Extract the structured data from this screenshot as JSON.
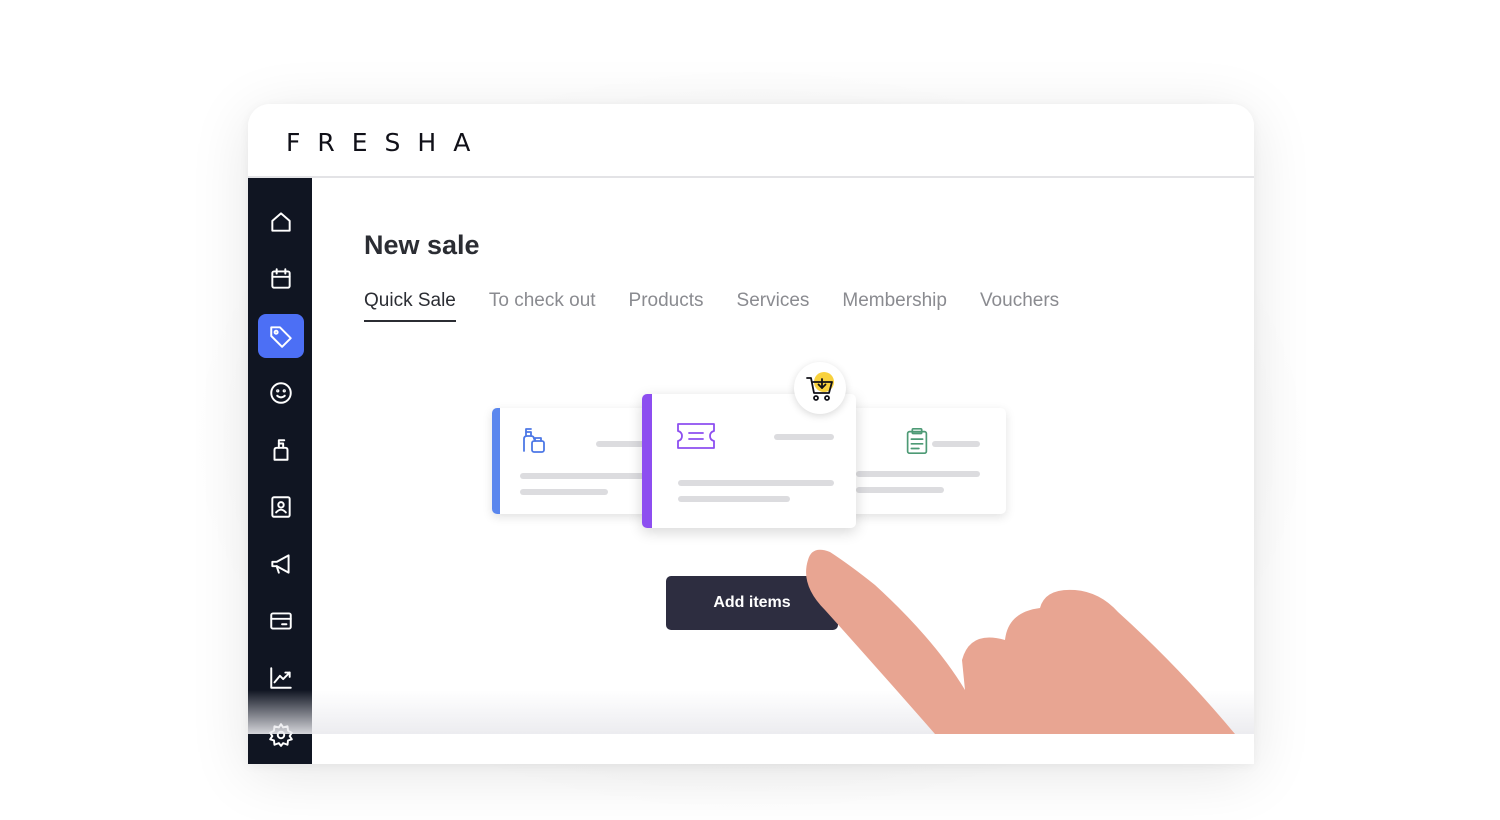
{
  "app": {
    "logo_text": "FRESHA"
  },
  "sidebar": {
    "items": [
      {
        "icon": "home-icon",
        "active": false
      },
      {
        "icon": "calendar-icon",
        "active": false
      },
      {
        "icon": "tag-icon",
        "active": true
      },
      {
        "icon": "smiley-icon",
        "active": false
      },
      {
        "icon": "bottle-icon",
        "active": false
      },
      {
        "icon": "contact-card-icon",
        "active": false
      },
      {
        "icon": "megaphone-icon",
        "active": false
      },
      {
        "icon": "credit-card-icon",
        "active": false
      },
      {
        "icon": "chart-icon",
        "active": false
      },
      {
        "icon": "gear-icon",
        "active": false
      }
    ],
    "colors": {
      "background": "#101522",
      "active": "#4c6ff5"
    }
  },
  "main": {
    "title": "New sale",
    "tabs": [
      {
        "label": "Quick Sale",
        "active": true
      },
      {
        "label": "To check out",
        "active": false
      },
      {
        "label": "Products",
        "active": false
      },
      {
        "label": "Services",
        "active": false
      },
      {
        "label": "Membership",
        "active": false
      },
      {
        "label": "Vouchers",
        "active": false
      }
    ],
    "cards": [
      {
        "icon": "product-bottle-icon",
        "accent": "#5b87ee"
      },
      {
        "icon": "voucher-ticket-icon",
        "accent": "#8d4ef0"
      },
      {
        "icon": "clipboard-icon",
        "accent": "#4d9a75"
      }
    ],
    "badge_icon": "cart-add-icon",
    "add_button_label": "Add items"
  }
}
